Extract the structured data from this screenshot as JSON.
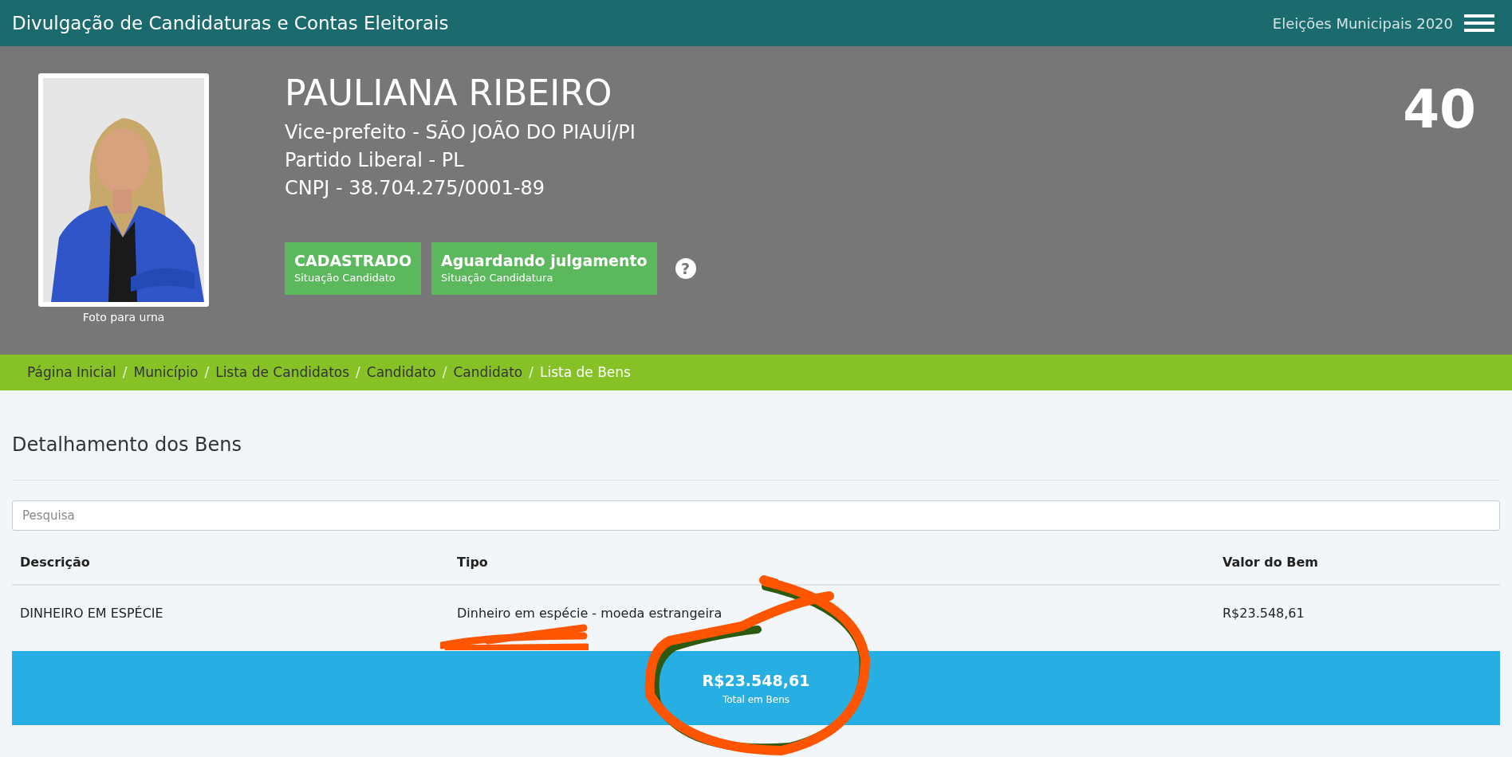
{
  "header": {
    "title": "Divulgação de Candidaturas e Contas Eleitorais",
    "election": "Eleições Municipais 2020"
  },
  "candidate": {
    "photo": {
      "kind": "picture",
      "caption": "Foto para urna"
    },
    "name": "PAULIANA RIBEIRO",
    "details": [
      "Vice-prefeito - SÃO JOÃO DO PIAUÍ/PI",
      "Partido Liberal - PL",
      "CNPJ - 38.704.275/0001-89"
    ],
    "number": "40",
    "badges": [
      {
        "title": "CADASTRADO",
        "subtitle": "Situação Candidato"
      },
      {
        "title": "Aguardando julgamento",
        "subtitle": "Situação Candidatura"
      }
    ],
    "help": "?"
  },
  "breadcrumb_separator": "/",
  "breadcrumb": [
    {
      "label": "Página Inicial",
      "selected": false
    },
    {
      "label": "Município",
      "selected": false
    },
    {
      "label": "Lista de Candidatos",
      "selected": false
    },
    {
      "label": "Candidato",
      "selected": false
    },
    {
      "label": "Candidato",
      "selected": false
    },
    {
      "label": "Lista de Bens",
      "selected": true
    }
  ],
  "section_title": "Detalhamento dos Bens",
  "search": {
    "placeholder": "Pesquisa"
  },
  "table": {
    "columns": [
      "Descrição",
      "Tipo",
      "Valor do Bem"
    ],
    "rows": [
      [
        "DINHEIRO EM ESPÉCIE",
        "Dinheiro em espécie - moeda estrangeira",
        "R$23.548,61"
      ]
    ]
  },
  "total": {
    "value": "R$23.548,61",
    "label": "Total em Bens"
  },
  "annotations": {
    "underline": true,
    "circle": true
  }
}
